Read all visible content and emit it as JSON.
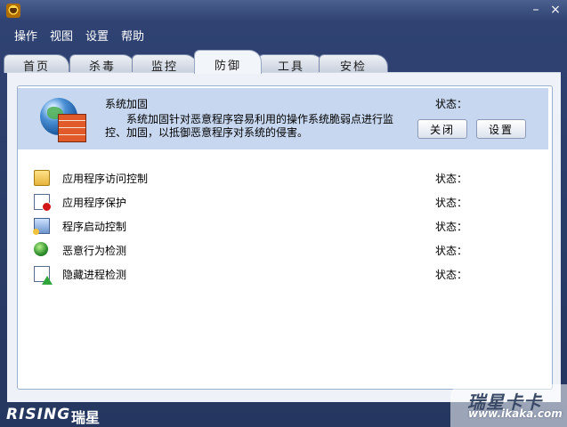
{
  "window": {
    "icon": "rising-lion-icon",
    "controls": {
      "minimize": "–",
      "close": "×"
    }
  },
  "menu": [
    "操作",
    "视图",
    "设置",
    "帮助"
  ],
  "tabs": [
    "首页",
    "杀毒",
    "监控",
    "防御",
    "工具",
    "安检"
  ],
  "active_tab": "防御",
  "system_hardening": {
    "title": "系统加固",
    "description": "系统加固针对恶意程序容易利用的操作系统脆弱点进行监控、加固，以抵御恶意程序对系统的侵害。",
    "status_label": "状态：",
    "close_button": "关闭",
    "settings_button": "设置",
    "icon": "globe-firewall-icon"
  },
  "items": [
    {
      "label": "应用程序访问控制",
      "status_label": "状态：",
      "icon": "folder-lock-icon"
    },
    {
      "label": "应用程序保护",
      "status_label": "状态：",
      "icon": "app-protect-icon"
    },
    {
      "label": "程序启动控制",
      "status_label": "状态：",
      "icon": "startup-control-icon"
    },
    {
      "label": "恶意行为检测",
      "status_label": "状态：",
      "icon": "behavior-detect-icon"
    },
    {
      "label": "隐藏进程检测",
      "status_label": "状态：",
      "icon": "hidden-process-icon"
    }
  ],
  "footer": {
    "brand_en": "RISING",
    "brand_cn": "瑞星"
  },
  "watermark": {
    "cn": "瑞星卡卡",
    "url": "www.ikaka.com"
  }
}
